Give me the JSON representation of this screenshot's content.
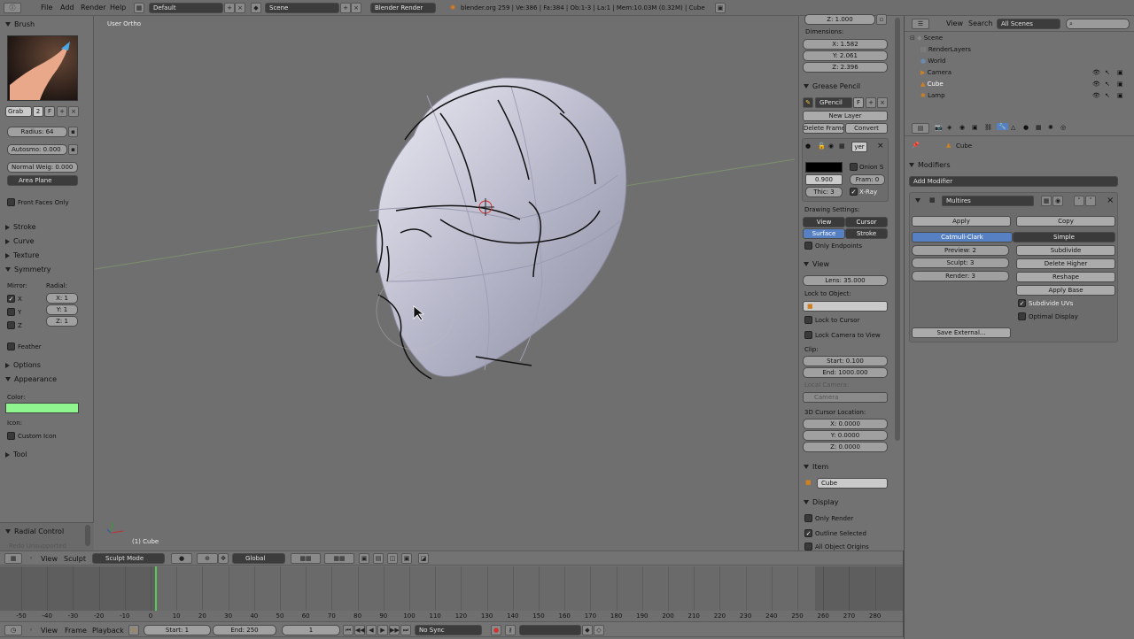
{
  "topbar": {
    "menus": [
      "File",
      "Add",
      "Render",
      "Help"
    ],
    "layout": "Default",
    "scene": "Scene",
    "engine": "Blender Render",
    "stats": "blender.org 259 | Ve:386 | Fa:384 | Ob:1-3 | La:1 | Mem:10.03M (0.32M) | Cube"
  },
  "toolshelf": {
    "brush_header": "Brush",
    "brush_name": "Grab",
    "brush_users": "2",
    "brush_f": "F",
    "radius": "Radius: 64",
    "autosmooth": "Autosmo: 0.000",
    "normal_weight": "Normal Weig: 0.000",
    "area_plane": "Area Plane",
    "front_faces": "Front Faces Only",
    "stroke": "Stroke",
    "curve": "Curve",
    "texture": "Texture",
    "symmetry": "Symmetry",
    "mirror": "Mirror:",
    "radial": "Radial:",
    "axes": [
      "X",
      "Y",
      "Z"
    ],
    "radial_x": "X: 1",
    "radial_y": "Y: 1",
    "radial_z": "Z: 1",
    "feather": "Feather",
    "options": "Options",
    "appearance": "Appearance",
    "color_label": "Color:",
    "icon_label": "Icon:",
    "custom_icon": "Custom Icon",
    "tool": "Tool",
    "radial_control": "Radial Control",
    "redo_unsupported": "Redo Unsupported",
    "brush_color": "#8ff58f"
  },
  "viewport": {
    "view_name": "User Ortho",
    "object_label": "(1) Cube"
  },
  "properties_n": {
    "z_top": "Z: 1.000",
    "dimensions": "Dimensions:",
    "dim_x": "X: 1.582",
    "dim_y": "Y: 2.061",
    "dim_z": "Z: 2.396",
    "grease_pencil": "Grease Pencil",
    "gpencil": "GPencil",
    "gp_f": "F",
    "new_layer": "New Layer",
    "delete_frame": "Delete Frame",
    "convert": "Convert",
    "layer_name": "yer",
    "onion": "Onion S",
    "opacity": "0.900",
    "frame": "Fram: 0",
    "thickness": "Thic: 3",
    "xray": "X-Ray",
    "drawing_settings": "Drawing Settings:",
    "view_btn": "View",
    "cursor_btn": "Cursor",
    "surface_btn": "Surface",
    "stroke_btn": "Stroke",
    "only_endpoints": "Only Endpoints",
    "view_header": "View",
    "lens": "Lens: 35.000",
    "lock_to_object": "Lock to Object:",
    "lock_to_cursor": "Lock to Cursor",
    "lock_camera": "Lock Camera to View",
    "clip": "Clip:",
    "clip_start": "Start: 0.100",
    "clip_end": "End: 1000.000",
    "local_camera": "Local Camera:",
    "camera": "Camera",
    "cursor_loc": "3D Cursor Location:",
    "cur_x": "X: 0.0000",
    "cur_y": "Y: 0.0000",
    "cur_z": "Z: 0.0000",
    "item": "Item",
    "item_name": "Cube",
    "display": "Display",
    "only_render": "Only Render",
    "outline_selected": "Outline Selected",
    "all_object_origins": "All Object Origins"
  },
  "outliner": {
    "view": "View",
    "search": "Search",
    "all_scenes": "All Scenes",
    "items": [
      "Scene",
      "RenderLayers",
      "World",
      "Camera",
      "Cube",
      "Lamp"
    ]
  },
  "modifiers": {
    "object": "Cube",
    "header": "Modifiers",
    "add_modifier": "Add Modifier",
    "name": "Multires",
    "apply": "Apply",
    "copy": "Copy",
    "catmull": "Catmull-Clark",
    "simple": "Simple",
    "preview": "Preview: 2",
    "sculpt": "Sculpt: 3",
    "render": "Render: 3",
    "subdivide": "Subdivide",
    "delete_higher": "Delete Higher",
    "reshape": "Reshape",
    "apply_base": "Apply Base",
    "subdivide_uvs": "Subdivide UVs",
    "optimal_display": "Optimal Display",
    "save_external": "Save External..."
  },
  "view3d_header": {
    "view": "View",
    "sculpt": "Sculpt",
    "mode": "Sculpt Mode",
    "orientation": "Global"
  },
  "timeline": {
    "ticks": [
      "-50",
      "-40",
      "-30",
      "-20",
      "-10",
      "0",
      "10",
      "20",
      "30",
      "40",
      "50",
      "60",
      "70",
      "80",
      "90",
      "100",
      "110",
      "120",
      "130",
      "140",
      "150",
      "160",
      "170",
      "180",
      "190",
      "200",
      "210",
      "220",
      "230",
      "240",
      "250",
      "260",
      "270",
      "280"
    ],
    "view": "View",
    "frame": "Frame",
    "playback": "Playback",
    "start": "Start: 1",
    "end": "End: 250",
    "current": "1",
    "sync": "No Sync"
  }
}
